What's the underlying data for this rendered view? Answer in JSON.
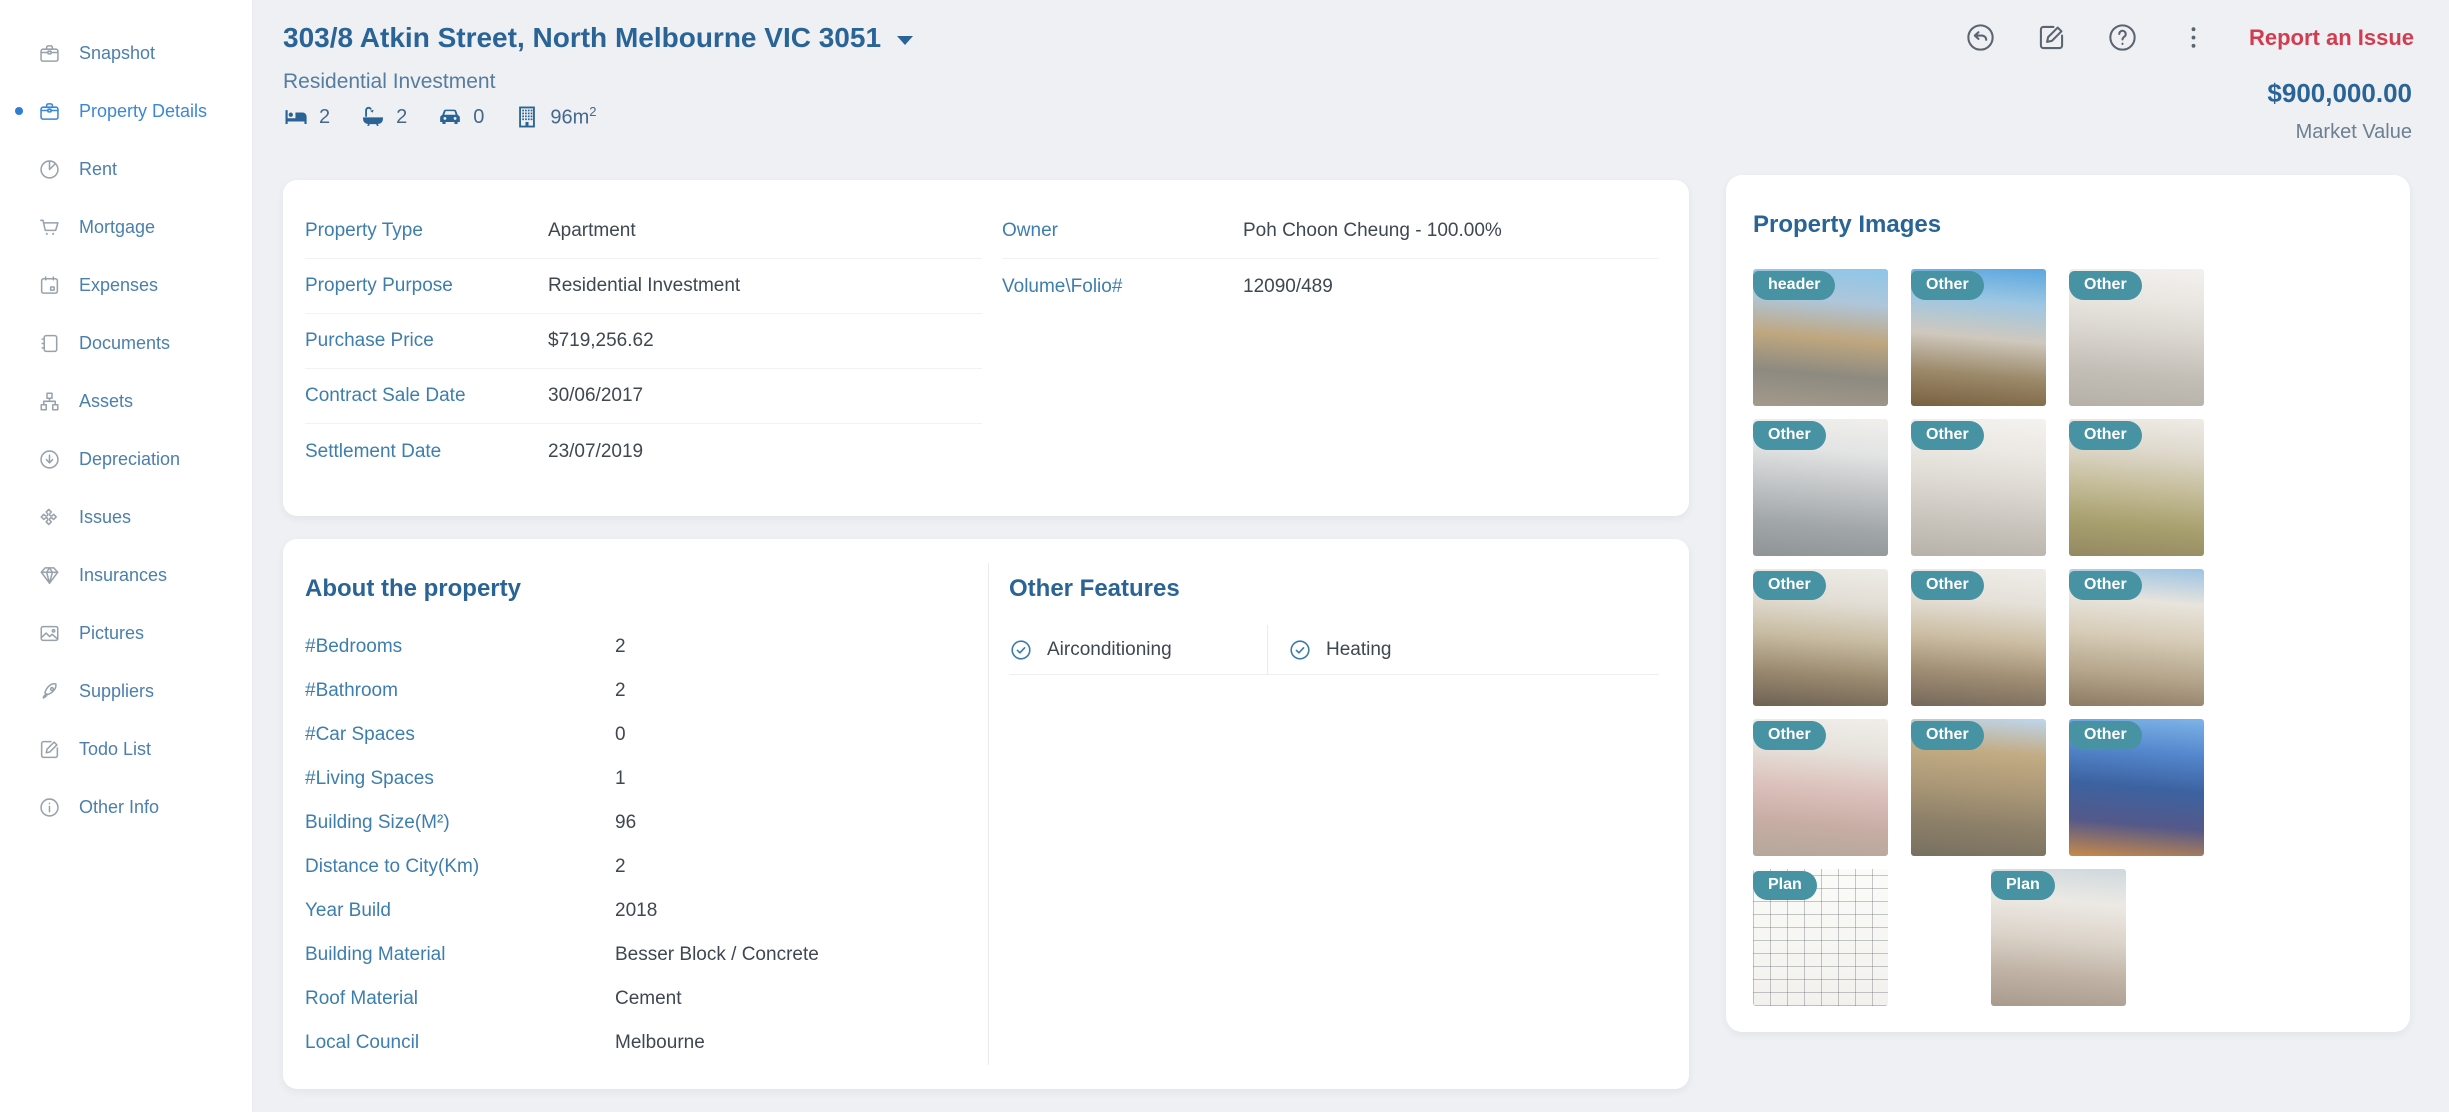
{
  "colors": {
    "accent_blue": "#2a6496",
    "link_blue": "#3d7eae",
    "sidebar_active": "#3b87d8",
    "report_red": "#d23c50",
    "badge_teal": "#4793a4",
    "background": "#eef0f4"
  },
  "sidebar": {
    "items": [
      {
        "label": "Snapshot",
        "icon": "briefcase-icon",
        "active": false
      },
      {
        "label": "Property Details",
        "icon": "briefcase-icon",
        "active": true
      },
      {
        "label": "Rent",
        "icon": "pie-chart-icon",
        "active": false
      },
      {
        "label": "Mortgage",
        "icon": "cart-icon",
        "active": false
      },
      {
        "label": "Expenses",
        "icon": "calendar-icon",
        "active": false
      },
      {
        "label": "Documents",
        "icon": "notebook-icon",
        "active": false
      },
      {
        "label": "Assets",
        "icon": "sitemap-icon",
        "active": false
      },
      {
        "label": "Depreciation",
        "icon": "arrow-down-circle-icon",
        "active": false
      },
      {
        "label": "Issues",
        "icon": "puzzle-icon",
        "active": false
      },
      {
        "label": "Insurances",
        "icon": "gem-icon",
        "active": false
      },
      {
        "label": "Pictures",
        "icon": "image-icon",
        "active": false
      },
      {
        "label": "Suppliers",
        "icon": "rocket-icon",
        "active": false
      },
      {
        "label": "Todo List",
        "icon": "edit-square-icon",
        "active": false
      },
      {
        "label": "Other Info",
        "icon": "info-circle-icon",
        "active": false
      }
    ]
  },
  "header": {
    "title": "303/8 Atkin Street, North Melbourne VIC 3051",
    "subtitle": "Residential Investment",
    "stats": [
      {
        "icon": "bed-icon",
        "value": "2"
      },
      {
        "icon": "bath-icon",
        "value": "2"
      },
      {
        "icon": "car-icon",
        "value": "0"
      },
      {
        "icon": "building-icon",
        "value": "96m",
        "sup": "2"
      }
    ],
    "actions": [
      {
        "icon": "undo-circle-icon",
        "name": "back-button"
      },
      {
        "icon": "edit-square-icon",
        "name": "edit-button"
      },
      {
        "icon": "help-circle-icon",
        "name": "help-button"
      },
      {
        "icon": "kebab-icon",
        "name": "more-menu-button"
      }
    ],
    "report_label": "Report an Issue",
    "market_value": "$900,000.00",
    "market_value_label": "Market Value"
  },
  "details": {
    "left": [
      {
        "label": "Property Type",
        "value": "Apartment"
      },
      {
        "label": "Property Purpose",
        "value": "Residential Investment"
      },
      {
        "label": "Purchase Price",
        "value": "$719,256.62"
      },
      {
        "label": "Contract Sale Date",
        "value": "30/06/2017"
      },
      {
        "label": "Settlement Date",
        "value": "23/07/2019"
      }
    ],
    "right": [
      {
        "label": "Owner",
        "value": "Poh Choon Cheung - 100.00%"
      },
      {
        "label": "Volume\\Folio#",
        "value": "12090/489"
      }
    ]
  },
  "about": {
    "title": "About the property",
    "rows": [
      {
        "label": "#Bedrooms",
        "value": "2"
      },
      {
        "label": "#Bathroom",
        "value": "2"
      },
      {
        "label": "#Car Spaces",
        "value": "0"
      },
      {
        "label": "#Living Spaces",
        "value": "1"
      },
      {
        "label": "Building Size(M²)",
        "value": "96"
      },
      {
        "label": "Distance to City(Km)",
        "value": "2"
      },
      {
        "label": "Year Build",
        "value": "2018"
      },
      {
        "label": "Building Material",
        "value": "Besser Block / Concrete"
      },
      {
        "label": "Roof Material",
        "value": "Cement"
      },
      {
        "label": "Local Council",
        "value": "Melbourne"
      }
    ]
  },
  "features": {
    "title": "Other Features",
    "items": [
      {
        "label": "Airconditioning",
        "icon": "check-circle-icon"
      },
      {
        "label": "Heating",
        "icon": "check-circle-icon"
      }
    ]
  },
  "images": {
    "title": "Property Images",
    "items": [
      {
        "badge": "header",
        "name": "building-exterior-front",
        "plan": false,
        "colors": [
          "#8ec6ea",
          "#aec6d9",
          "#bfa77f",
          "#8d8a80",
          "#a39a8b"
        ]
      },
      {
        "badge": "Other",
        "name": "balcony-street-view",
        "plan": false,
        "colors": [
          "#5aa7e0",
          "#9ec7e2",
          "#cfc8bd",
          "#9c8a6a",
          "#77603f"
        ]
      },
      {
        "badge": "Other",
        "name": "bathroom-shower",
        "plan": false,
        "colors": [
          "#f3f1ee",
          "#e9e6e1",
          "#d8d4cd",
          "#c2bdb5",
          "#b5b0a8"
        ]
      },
      {
        "badge": "Other",
        "name": "bedroom-main",
        "plan": false,
        "colors": [
          "#f0efec",
          "#e2e3e3",
          "#c2c5c6",
          "#a2a7a9",
          "#8f9496"
        ]
      },
      {
        "badge": "Other",
        "name": "bathroom-vanity",
        "plan": false,
        "colors": [
          "#f4f2ef",
          "#ebe8e3",
          "#dcd8d1",
          "#c8c3bb",
          "#b7b2a9"
        ]
      },
      {
        "badge": "Other",
        "name": "bedroom-second",
        "plan": false,
        "colors": [
          "#efece6",
          "#ded8cc",
          "#c5bd9a",
          "#a8a06e",
          "#948862"
        ]
      },
      {
        "badge": "Other",
        "name": "kitchen-island",
        "plan": false,
        "colors": [
          "#eeece7",
          "#e2ddd4",
          "#c8bca2",
          "#9a8a70",
          "#6e6153"
        ]
      },
      {
        "badge": "Other",
        "name": "kitchen-galley",
        "plan": false,
        "colors": [
          "#efede9",
          "#e5e0d8",
          "#cdbfa5",
          "#a08e74",
          "#75685a"
        ]
      },
      {
        "badge": "Other",
        "name": "living-room-windows",
        "plan": false,
        "colors": [
          "#9cc4e4",
          "#e8e4dc",
          "#d6cbb6",
          "#b5a68c",
          "#8d7b63"
        ]
      },
      {
        "badge": "Other",
        "name": "living-dining-area",
        "plan": false,
        "colors": [
          "#f0eeea",
          "#e6e1da",
          "#dcc2bc",
          "#c7ada4",
          "#b5a79a"
        ]
      },
      {
        "badge": "Other",
        "name": "building-facade",
        "plan": false,
        "colors": [
          "#bdd7ec",
          "#c3ac84",
          "#ab9877",
          "#8d8069",
          "#77705f"
        ]
      },
      {
        "badge": "Other",
        "name": "building-exterior-dusk",
        "plan": false,
        "colors": [
          "#7db4e8",
          "#5487cd",
          "#3c62a0",
          "#54598a",
          "#c88a4a"
        ]
      },
      {
        "badge": "Plan",
        "name": "floor-plan",
        "plan": true,
        "colors": []
      },
      {
        "badge": "Plan",
        "name": "living-room-balcony",
        "plan": false,
        "colors": [
          "#cfd8de",
          "#ece9e4",
          "#dcd4ca",
          "#c0b3a5",
          "#a89a8c"
        ],
        "offset": true
      }
    ]
  }
}
